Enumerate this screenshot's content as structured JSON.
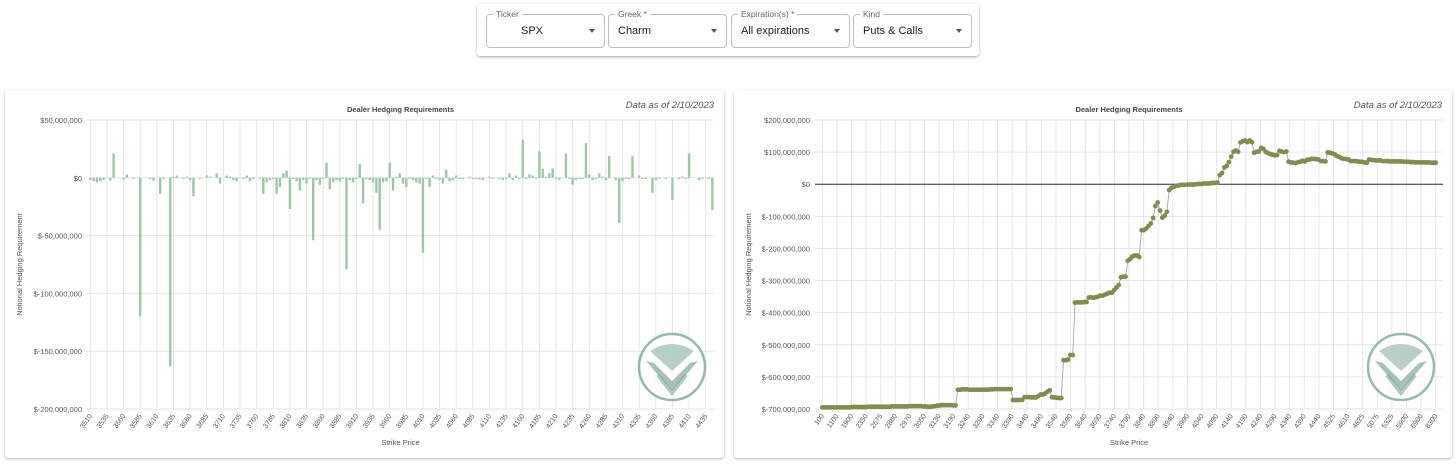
{
  "filters": [
    {
      "label": "Ticker",
      "value": "SPX"
    },
    {
      "label": "Greek *",
      "value": "Charm"
    },
    {
      "label": "Expiration(s) *",
      "value": "All expirations"
    },
    {
      "label": "Kind",
      "value": "Puts & Calls"
    }
  ],
  "colors": {
    "bar": "#9fc4a8",
    "point": "#858a52",
    "line": "#9a9a9a",
    "grid": "#e6e6e6",
    "logo": "#7fa79c"
  },
  "chart_data": [
    {
      "type": "bar",
      "title": "Dealer Hedging Requirements",
      "as_of": "Data as of 2/10/2023",
      "xlabel": "Strike Price",
      "ylabel": "Notional Hedging Requirement",
      "ylim": [
        -200000000,
        50000000
      ],
      "yticks": [
        50000000,
        0,
        -50000000,
        -100000000,
        -150000000,
        -200000000
      ],
      "ytick_labels": [
        "$50,000,000",
        "$0",
        "$-50,000,000",
        "$-100,000,000",
        "$-150,000,000",
        "$-200,000,000"
      ],
      "categories": [
        "3510",
        "3535",
        "3560",
        "3585",
        "3610",
        "3635",
        "3660",
        "3685",
        "3710",
        "3735",
        "3760",
        "3785",
        "3810",
        "3835",
        "3860",
        "3885",
        "3910",
        "3935",
        "3960",
        "3985",
        "4010",
        "4035",
        "4060",
        "4085",
        "4110",
        "4135",
        "4160",
        "4185",
        "4210",
        "4235",
        "4260",
        "4285",
        "4310",
        "4335",
        "4360",
        "4385",
        "4410",
        "4435"
      ],
      "bar_x": [
        3510,
        3515,
        3520,
        3525,
        3530,
        3540,
        3545,
        3560,
        3565,
        3575,
        3585,
        3600,
        3605,
        3615,
        3620,
        3630,
        3635,
        3640,
        3650,
        3655,
        3660,
        3665,
        3675,
        3685,
        3690,
        3700,
        3705,
        3715,
        3720,
        3725,
        3730,
        3740,
        3745,
        3750,
        3755,
        3765,
        3770,
        3775,
        3780,
        3785,
        3790,
        3795,
        3800,
        3805,
        3810,
        3815,
        3820,
        3825,
        3830,
        3835,
        3840,
        3845,
        3850,
        3855,
        3860,
        3865,
        3870,
        3875,
        3880,
        3885,
        3890,
        3895,
        3900,
        3905,
        3910,
        3915,
        3920,
        3925,
        3930,
        3935,
        3940,
        3945,
        3950,
        3955,
        3960,
        3965,
        3970,
        3975,
        3980,
        3985,
        3990,
        3995,
        4000,
        4005,
        4010,
        4015,
        4020,
        4025,
        4030,
        4035,
        4040,
        4045,
        4050,
        4055,
        4060,
        4065,
        4070,
        4080,
        4085,
        4090,
        4095,
        4100,
        4110,
        4115,
        4125,
        4130,
        4135,
        4140,
        4145,
        4150,
        4155,
        4160,
        4165,
        4170,
        4175,
        4180,
        4185,
        4190,
        4195,
        4200,
        4205,
        4210,
        4215,
        4225,
        4230,
        4235,
        4240,
        4245,
        4250,
        4255,
        4260,
        4265,
        4270,
        4275,
        4280,
        4285,
        4290,
        4300,
        4305,
        4310,
        4315,
        4320,
        4325,
        4335,
        4340,
        4345,
        4355,
        4360,
        4365,
        4375,
        4385,
        4395,
        4400,
        4405,
        4410,
        4425,
        4430,
        4440,
        4445
      ],
      "bar_y": [
        -2000000,
        -3000000,
        -4000000,
        -3000000,
        -2000000,
        -2500000,
        21000000,
        -1500000,
        3000000,
        -1000000,
        -120000000,
        -1000000,
        -2500000,
        -14000000,
        -1000000,
        -163000000,
        1000000,
        2000000,
        -1000000,
        1000000,
        -2000000,
        -16000000,
        -1000000,
        2000000,
        1000000,
        4000000,
        -5000000,
        2000000,
        1000000,
        -2000000,
        -3000000,
        -1000000,
        2000000,
        -3000000,
        -1000000,
        -1000000,
        -14000000,
        -4000000,
        -2000000,
        -1000000,
        -14000000,
        -8000000,
        4000000,
        6000000,
        -27000000,
        -1000000,
        -3000000,
        -11000000,
        -2000000,
        -5000000,
        -1000000,
        -54000000,
        -2000000,
        -6000000,
        -1000000,
        13000000,
        -10000000,
        -4000000,
        -2000000,
        -3000000,
        -1000000,
        -79000000,
        -2000000,
        -4000000,
        -1000000,
        12000000,
        -22000000,
        -1000000,
        -2000000,
        -4000000,
        -13000000,
        -45000000,
        -4000000,
        -3000000,
        13000000,
        -11000000,
        1000000,
        4000000,
        -5000000,
        -8000000,
        -1000000,
        -2000000,
        -4000000,
        -5000000,
        -65000000,
        -1000000,
        -8000000,
        2000000,
        -1000000,
        -2000000,
        -5000000,
        7000000,
        -3000000,
        -2000000,
        2000000,
        -1000000,
        -1000000,
        1000000,
        -1000000,
        -1000000,
        -1500000,
        -2000000,
        1000000,
        -1000000,
        -1000000,
        -2000000,
        -1000000,
        4000000,
        -2000000,
        2000000,
        -1000000,
        33000000,
        -1000000,
        3000000,
        2000000,
        -1000000,
        23000000,
        8000000,
        1000000,
        4000000,
        8000000,
        -1000000,
        -2000000,
        21000000,
        -1000000,
        -6000000,
        -2000000,
        -1000000,
        -1000000,
        30000000,
        3000000,
        -2000000,
        -1000000,
        4000000,
        1000000,
        -2000000,
        19000000,
        -2000000,
        -39000000,
        -3000000,
        -1000000,
        -1000000,
        19000000,
        2000000,
        -1000000,
        -1000000,
        -13000000,
        -2000000,
        -1000000,
        -1000000,
        -19000000,
        -1000000,
        1000000,
        -1000000,
        21000000,
        -2000000,
        -1000000,
        -1000000,
        -28000000,
        -1000000,
        -2000000,
        -3000000,
        -4000000,
        -2000000,
        4000000,
        -1000000
      ]
    },
    {
      "type": "line",
      "title": "Dealer Hedging Requirements",
      "as_of": "Data as of 2/10/2023",
      "xlabel": "Strike Price",
      "ylabel": "Notional Hedging Requirement",
      "ylim": [
        -700000000,
        200000000
      ],
      "yticks": [
        200000000,
        100000000,
        0,
        -100000000,
        -200000000,
        -300000000,
        -400000000,
        -500000000,
        -600000000,
        -700000000
      ],
      "ytick_labels": [
        "$200,000,000",
        "$100,000,000",
        "$0",
        "$-100,000,000",
        "$-200,000,000",
        "$-300,000,000",
        "$-400,000,000",
        "$-500,000,000",
        "$-600,000,000",
        "$-700,000,000"
      ],
      "tick_labels": [
        "100",
        "1100",
        "1900",
        "2350",
        "2675",
        "2880",
        "2970",
        "3050",
        "3130",
        "3190",
        "3240",
        "3290",
        "3340",
        "3390",
        "3440",
        "3490",
        "3540",
        "3590",
        "3640",
        "3690",
        "3740",
        "3790",
        "3840",
        "3890",
        "3940",
        "3990",
        "4040",
        "4090",
        "4140",
        "4190",
        "4240",
        "4290",
        "4340",
        "4390",
        "4440",
        "4525",
        "4610",
        "4825",
        "5075",
        "5325",
        "5900",
        "6900",
        "8300"
      ],
      "values": [
        -695000000,
        -695000000,
        -695000000,
        -695000000,
        -695000000,
        -695000000,
        -695000000,
        -695000000,
        -695000000,
        -695000000,
        -695000000,
        -695000000,
        -695000000,
        -694000000,
        -694000000,
        -694000000,
        -694000000,
        -694000000,
        -694000000,
        -694000000,
        -693000000,
        -693000000,
        -693000000,
        -693000000,
        -693000000,
        -693000000,
        -693000000,
        -693000000,
        -693000000,
        -693000000,
        -692000000,
        -692000000,
        -692000000,
        -692000000,
        -692000000,
        -692000000,
        -692000000,
        -692000000,
        -691000000,
        -691000000,
        -691000000,
        -691000000,
        -691000000,
        -691000000,
        -692000000,
        -692000000,
        -693000000,
        -693000000,
        -692000000,
        -691000000,
        -690000000,
        -689000000,
        -688000000,
        -688000000,
        -688000000,
        -688000000,
        -688000000,
        -689000000,
        -689000000,
        -640000000,
        -640000000,
        -639000000,
        -639000000,
        -639000000,
        -640000000,
        -640000000,
        -640000000,
        -640000000,
        -640000000,
        -640000000,
        -640000000,
        -640000000,
        -640000000,
        -639000000,
        -639000000,
        -638000000,
        -638000000,
        -638000000,
        -638000000,
        -638000000,
        -638000000,
        -638000000,
        -638000000,
        -672000000,
        -672000000,
        -672000000,
        -672000000,
        -672000000,
        -663000000,
        -663000000,
        -663000000,
        -664000000,
        -664000000,
        -664000000,
        -660000000,
        -655000000,
        -655000000,
        -652000000,
        -646000000,
        -642000000,
        -663000000,
        -664000000,
        -665000000,
        -666000000,
        -666000000,
        -548000000,
        -548000000,
        -546000000,
        -532000000,
        -532000000,
        -369000000,
        -368000000,
        -368000000,
        -368000000,
        -367000000,
        -367000000,
        -353000000,
        -352000000,
        -354000000,
        -352000000,
        -350000000,
        -347000000,
        -347000000,
        -344000000,
        -341000000,
        -338000000,
        -338000000,
        -330000000,
        -322000000,
        -314000000,
        -290000000,
        -288000000,
        -288000000,
        -238000000,
        -233000000,
        -225000000,
        -222000000,
        -222000000,
        -227000000,
        -143000000,
        -143000000,
        -138000000,
        -130000000,
        -122000000,
        -105000000,
        -68000000,
        -57000000,
        -82000000,
        -104000000,
        -98000000,
        -86000000,
        -18000000,
        -11000000,
        -8000000,
        -5000000,
        -4000000,
        -2000000,
        -2000000,
        -2000000,
        -1000000,
        -1000000,
        -1000000,
        -1000000,
        0,
        1000000,
        1000000,
        2000000,
        2000000,
        2000000,
        3000000,
        4000000,
        4000000,
        5000000,
        28000000,
        35000000,
        52000000,
        57000000,
        69000000,
        86000000,
        101000000,
        105000000,
        101000000,
        130000000,
        134000000,
        136000000,
        131000000,
        136000000,
        131000000,
        98000000,
        101000000,
        102000000,
        113000000,
        110000000,
        101000000,
        97000000,
        94000000,
        92000000,
        90000000,
        91000000,
        104000000,
        102000000,
        100000000,
        102000000,
        70000000,
        68000000,
        67000000,
        66000000,
        68000000,
        70000000,
        73000000,
        71000000,
        76000000,
        77000000,
        79000000,
        79000000,
        78000000,
        77000000,
        72000000,
        72000000,
        71000000,
        99000000,
        98000000,
        96000000,
        93000000,
        88000000,
        85000000,
        81000000,
        79000000,
        78000000,
        77000000,
        72000000,
        72000000,
        72000000,
        71000000,
        70000000,
        70000000,
        68000000,
        67000000,
        77000000,
        76000000,
        75000000,
        74000000,
        74000000,
        74000000,
        72000000,
        72000000,
        72000000,
        71000000,
        71000000,
        71000000,
        71000000,
        71000000,
        71000000,
        70000000,
        70000000,
        70000000,
        69000000,
        69000000,
        68000000,
        68000000,
        68000000,
        68000000,
        68000000,
        68000000,
        68000000,
        67000000,
        67000000,
        67000000
      ]
    }
  ]
}
